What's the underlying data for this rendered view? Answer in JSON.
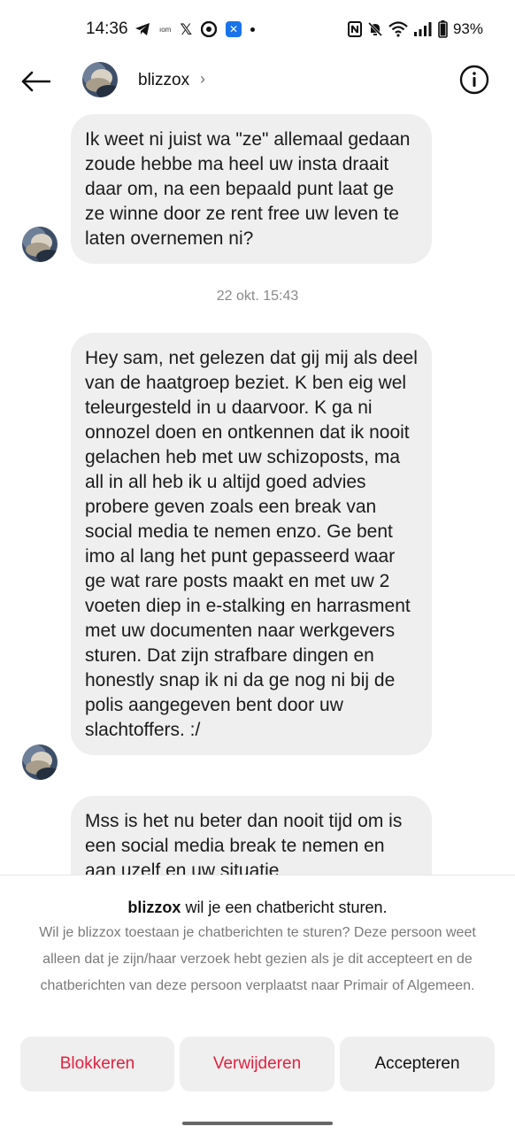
{
  "status_bar": {
    "time": "14:36",
    "battery": "93%",
    "left_icons": [
      "telegram-icon",
      "carrier-tiny-icon",
      "x-icon",
      "chrome-icon",
      "app-blue-icon",
      "dot-icon"
    ],
    "right_icons": [
      "nfc-icon",
      "mute-icon",
      "wifi-icon",
      "signal-icon",
      "battery-icon"
    ]
  },
  "header": {
    "username": "blizzox",
    "chevron": "›"
  },
  "messages": [
    {
      "text": "Ik weet ni juist wa \"ze\" allemaal gedaan zoude hebbe ma heel uw insta draait daar om, na een bepaald punt laat ge ze winne door ze rent free uw leven te laten overnemen ni?"
    },
    {
      "text": "Hey sam, net gelezen dat gij mij als deel van de haatgroep beziet. K ben eig wel teleurgesteld in u daarvoor. K ga ni onnozel doen en ontkennen dat ik nooit gelachen heb met uw schizoposts, ma all in all heb ik u altijd goed advies probere geven zoals een break van social media te nemen enzo. Ge bent imo al lang het punt gepasseerd waar ge wat rare posts maakt en met uw 2 voeten diep in e-stalking en harrasment met uw documenten naar werkgevers sturen. Dat zijn strafbare dingen en honestly snap ik ni da ge nog ni bij de polis aangegeven bent door uw slachtoffers. :/"
    },
    {
      "text": "Mss is het nu beter dan nooit tijd om is een social media break te nemen en aan uzelf en uw situatie"
    }
  ],
  "timestamp": "22 okt. 15:43",
  "request_sheet": {
    "title_user": "blizzox",
    "title_rest": " wil je een chatbericht sturen.",
    "description": "Wil je blizzox toestaan je chatberichten te sturen? Deze persoon weet alleen dat je zijn/haar verzoek hebt gezien als je dit accepteert en de chatberichten van deze persoon verplaatst naar Primair of Algemeen.",
    "buttons": {
      "block": "Blokkeren",
      "delete": "Verwijderen",
      "accept": "Accepteren"
    },
    "colors": {
      "destructive": "#e5203f",
      "button_bg": "#efefef"
    }
  }
}
